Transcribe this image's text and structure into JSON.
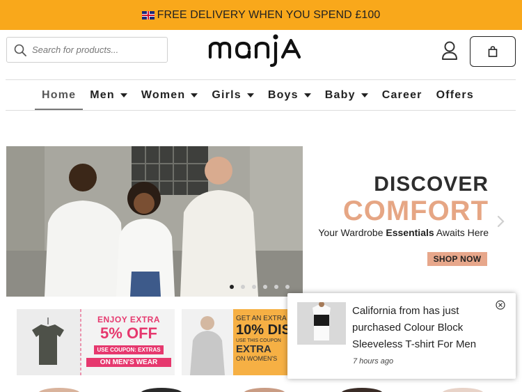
{
  "announcement": {
    "text": "FREE DELIVERY WHEN YOU SPEND £100"
  },
  "search": {
    "placeholder": "Search for products..."
  },
  "brand": {
    "logo_text": "manja"
  },
  "nav": {
    "items": [
      {
        "label": "Home",
        "active": true,
        "dropdown": false
      },
      {
        "label": "Men",
        "active": false,
        "dropdown": true
      },
      {
        "label": "Women",
        "active": false,
        "dropdown": true
      },
      {
        "label": "Girls",
        "active": false,
        "dropdown": true
      },
      {
        "label": "Boys",
        "active": false,
        "dropdown": true
      },
      {
        "label": "Baby",
        "active": false,
        "dropdown": true
      },
      {
        "label": "Career",
        "active": false,
        "dropdown": false
      },
      {
        "label": "Offers",
        "active": false,
        "dropdown": false
      }
    ]
  },
  "hero": {
    "line1": "DISCOVER",
    "line2": "COMFORT",
    "sub_prefix": "Your Wardrobe ",
    "sub_bold": "Essentials",
    "sub_suffix": " Awaits Here",
    "cta": "SHOP NOW",
    "slides_total": 6,
    "slide_active": 1
  },
  "promos": [
    {
      "line1": "ENJOY EXTRA",
      "big": "5% OFF",
      "coupon": "USE COUPON: EXTRAS",
      "footer": "ON MEN'S WEAR"
    },
    {
      "line1": "GET AN EXTRA",
      "big": "10% DIS",
      "coupon": "USE THIS COUPON",
      "code": "EXTRA",
      "footer": "ON WOMEN'S"
    }
  ],
  "toast": {
    "message": "California from has just purchased Colour Block Sleeveless T-shirt For Men",
    "time": "7 hours ago"
  },
  "colors": {
    "topbar": "#f9a81b",
    "accent_peach": "#e6a684",
    "promo_pink": "#e6386e",
    "promo_orange": "#f6b044"
  },
  "icons": [
    "search-icon",
    "user-icon",
    "cart-icon",
    "chevron-right-icon",
    "close-icon",
    "uk-flag-icon"
  ]
}
